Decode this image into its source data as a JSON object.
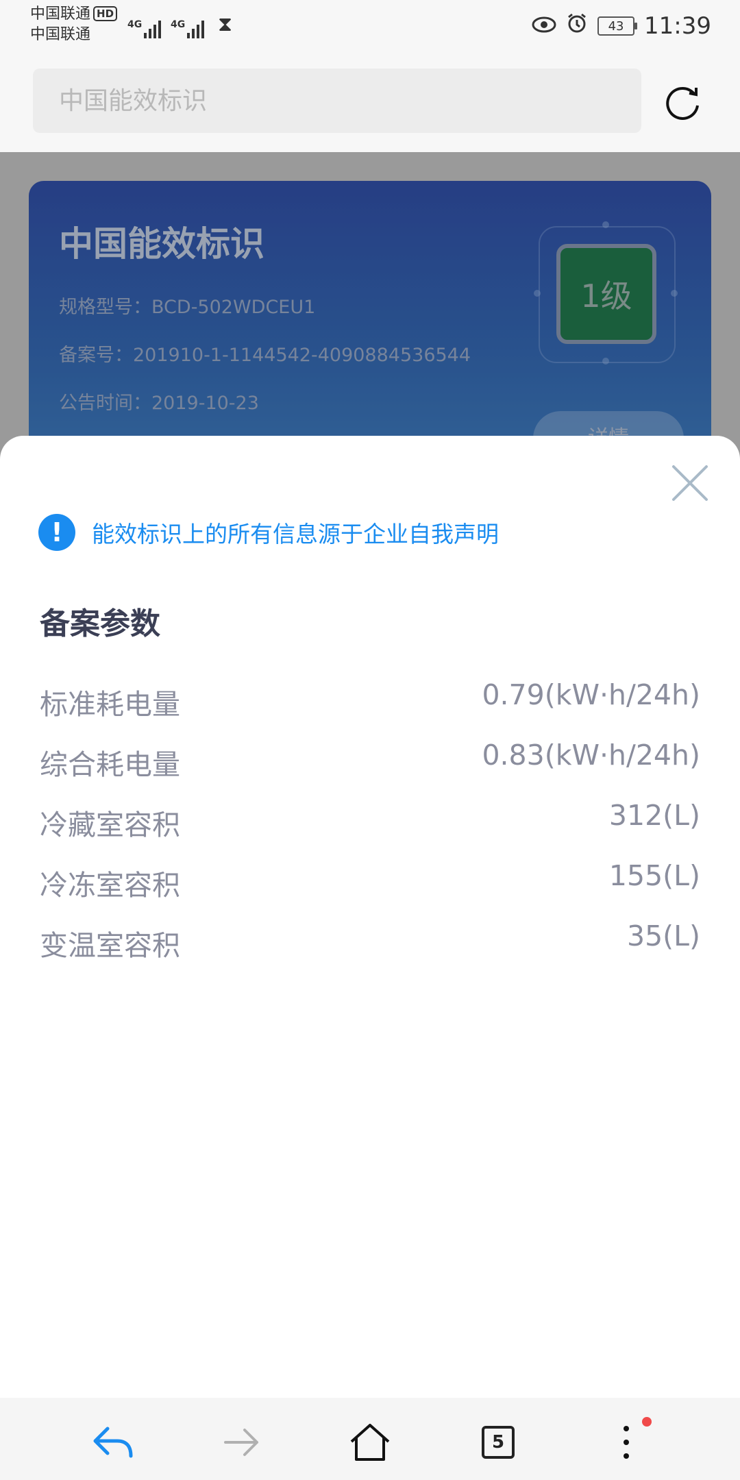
{
  "status_bar": {
    "carrier_1": "中国联通",
    "carrier_2": "中国联通",
    "hd_badge": "HD",
    "network_1": "4G",
    "network_2": "4G",
    "battery": "43",
    "time": "11:39"
  },
  "search": {
    "placeholder": "中国能效标识"
  },
  "card": {
    "title": "中国能效标识",
    "model_label": "规格型号：",
    "model_value": "BCD-502WDCEU1",
    "record_label": "备案号：",
    "record_value": "201910-1-1144542-4090884536544",
    "date_label": "公告时间：",
    "date_value": "2019-10-23",
    "grade": "1级",
    "detail_button": "详情"
  },
  "sheet": {
    "notice_icon": "!",
    "notice": "能效标识上的所有信息源于企业自我声明",
    "section_title": "备案参数",
    "params": [
      {
        "label": "标准耗电量",
        "value": "0.79(kW·h/24h)"
      },
      {
        "label": "综合耗电量",
        "value": "0.83(kW·h/24h)"
      },
      {
        "label": "冷藏室容积",
        "value": "312(L)"
      },
      {
        "label": "冷冻室容积",
        "value": "155(L)"
      },
      {
        "label": "变温室容积",
        "value": "35(L)"
      }
    ]
  },
  "bottom_nav": {
    "tabs_count": "5",
    "icons": [
      "back-icon",
      "forward-icon",
      "home-icon",
      "tabs-icon",
      "more-icon"
    ]
  },
  "colors": {
    "accent": "#1a8cf0",
    "grade_green": "#0f6a3c",
    "card_blue": "#1f3f9c",
    "notification_dot": "#f04a4a"
  }
}
